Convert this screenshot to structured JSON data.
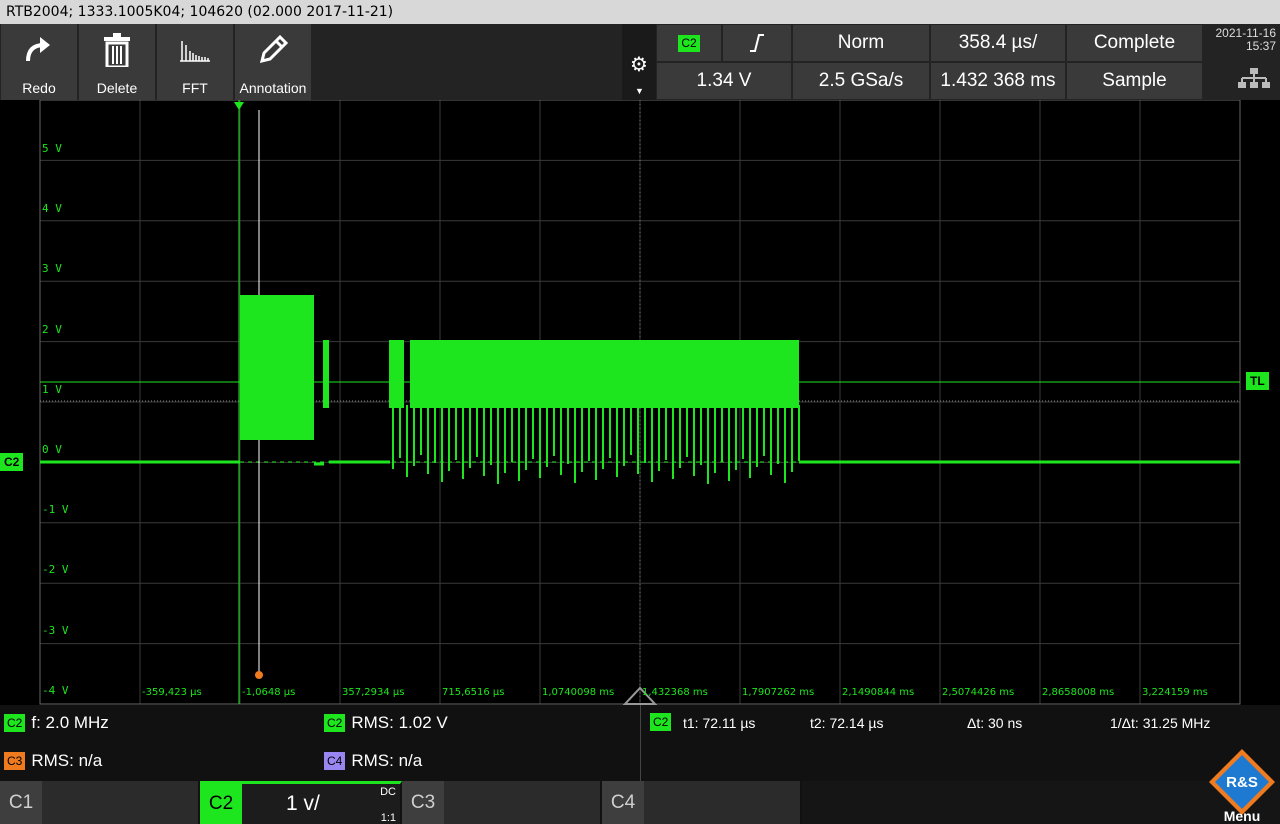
{
  "titlebar": {
    "text": "RTB2004; 1333.1005K04; 104620 (02.000 2017-11-21)"
  },
  "toolbar": {
    "buttons": [
      {
        "label": "Redo",
        "icon": "redo-icon"
      },
      {
        "label": "Delete",
        "icon": "trash-icon"
      },
      {
        "label": "FFT",
        "icon": "fft-icon"
      },
      {
        "label": "Annotation",
        "icon": "pencil-icon"
      }
    ]
  },
  "trigger": {
    "source_badge": "C2",
    "slope_symbol": "℠",
    "mode": "Norm",
    "timebase": "358.4 µs/",
    "acq_state": "Complete",
    "level": "1.34 V",
    "sample_rate": "2.5 GSa/s",
    "position": "1.432 368 ms",
    "acq_mode": "Sample"
  },
  "clock": {
    "date": "2021-11-16",
    "time": "15:37"
  },
  "plot": {
    "y_labels": [
      "5 V",
      "4 V",
      "3 V",
      "2 V",
      "1 V",
      "0 V",
      "-1 V",
      "-2 V",
      "-3 V",
      "-4 V"
    ],
    "x_labels": [
      "-359,423 µs",
      "-1,0648 µs",
      "357,2934 µs",
      "715,6516 µs",
      "1,0740098 ms",
      "1,432368 ms",
      "1,7907262 ms",
      "2,1490844 ms",
      "2,5074426 ms",
      "2,8658008 ms",
      "3,224159 ms"
    ],
    "channel_marker": "C2",
    "trigger_level_marker": "TL",
    "trace_color": "#1ee61e"
  },
  "measurements": {
    "row1": {
      "m1_badge": "C2",
      "m1_text": "f: 2.0 MHz",
      "m2_badge": "C2",
      "m2_text": "RMS: 1.02 V",
      "cursor_badge": "C2",
      "t1": "t1: 72.11 µs",
      "t2": "t2: 72.14 µs",
      "dt": "Δt: 30 ns",
      "inv_dt": "1/Δt: 31.25 MHz"
    },
    "row2": {
      "m3_badge": "C3",
      "m3_text": "RMS: n/a",
      "m4_badge": "C4",
      "m4_text": "RMS: n/a"
    }
  },
  "channels": [
    {
      "name": "C1",
      "value": "",
      "coupling": "",
      "probe": ""
    },
    {
      "name": "C2",
      "value": "1 v/",
      "coupling": "DC",
      "probe": "1:1"
    },
    {
      "name": "C3",
      "value": "",
      "coupling": "",
      "probe": ""
    },
    {
      "name": "C4",
      "value": "",
      "coupling": "",
      "probe": ""
    }
  ],
  "menu": {
    "logo_text": "R&S",
    "label": "Menu"
  },
  "colors": {
    "c2": "#1ee61e",
    "c3": "#f07a1e",
    "c4": "#9a86f0"
  }
}
